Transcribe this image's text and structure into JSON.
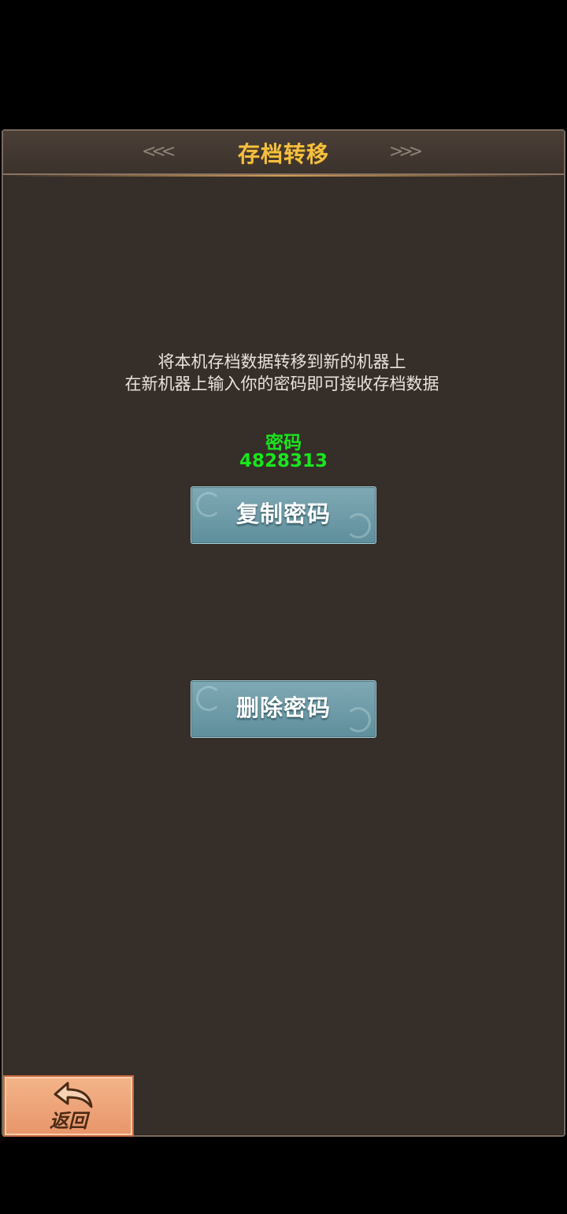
{
  "title": "存档转移",
  "description": {
    "line1": "将本机存档数据转移到新的机器上",
    "line2": "在新机器上输入你的密码即可接收存档数据"
  },
  "password": {
    "label": "密码",
    "value": "4828313"
  },
  "buttons": {
    "copy_label": "复制密码",
    "delete_label": "删除密码",
    "back_label": "返回"
  },
  "colors": {
    "title": "#f5c040",
    "password": "#19e61c",
    "panel": "#362e29",
    "button": "#6f9ca8",
    "back_button": "#ef9f75"
  },
  "icons": {
    "back": "return-arrow-icon",
    "ornament_left": "double-chevron-left-icon",
    "ornament_right": "double-chevron-right-icon"
  }
}
